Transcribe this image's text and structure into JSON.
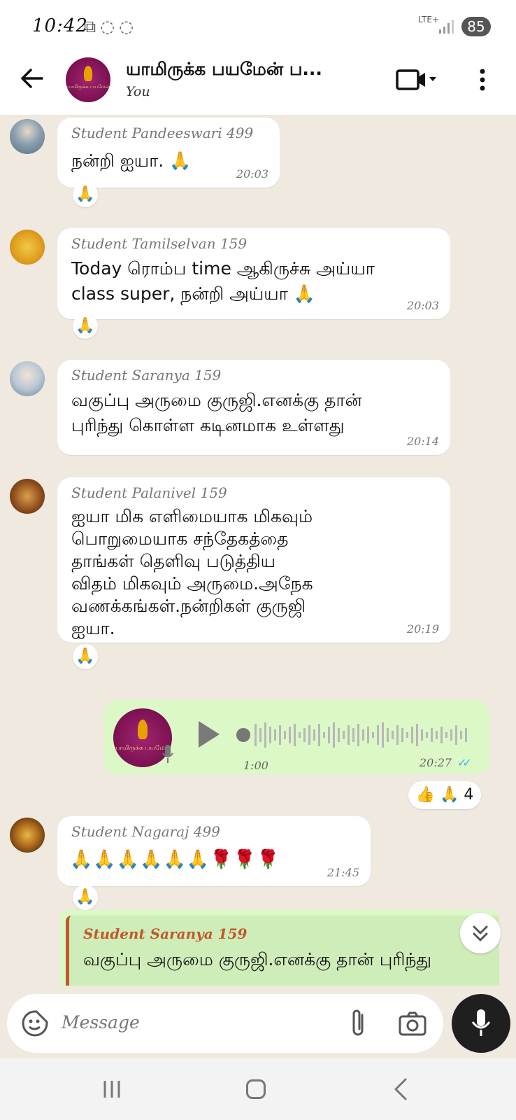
{
  "status_bar": {
    "time": "10:42",
    "network": "LTE+",
    "battery": "85"
  },
  "header": {
    "title": "யாமிருக்க பயமேன் ப...",
    "subtitle": "You",
    "avatar_text": "யாமிருக்க பயமேன்"
  },
  "messages": [
    {
      "sender": "Student Pandeeswari 499",
      "text": "நன்றி ஐயா. 🙏",
      "time": "20:03",
      "reaction": "🙏"
    },
    {
      "sender": "Student Tamilselvan 159",
      "lines": [
        "Today ரொம்ப time ஆகிருச்சு அய்யா",
        "class super, நன்றி அய்யா 🙏"
      ],
      "time": "20:03",
      "reaction": "🙏"
    },
    {
      "sender": "Student Saranya 159",
      "lines": [
        "வகுப்பு அருமை குருஜி.எனக்கு தான்",
        "புரிந்து கொள்ள கடினமாக உள்ளது"
      ],
      "time": "20:14"
    },
    {
      "sender": "Student Palanivel 159",
      "lines": [
        "ஐயா மிக எளிமையாக மிகவும்",
        "பொறுமையாக சந்தேகத்தை",
        "தாங்கள் தெளிவு படுத்திய",
        "விதம் மிகவும் அருமை.அநேக",
        "வணக்கங்கள்.நன்றிகள் குருஜி",
        "ஐயா."
      ],
      "time": "20:19",
      "reaction": "🙏"
    },
    {
      "sender": "Student Nagaraj 499",
      "text": "🙏🙏🙏🙏🙏🙏🌹🌹🌹",
      "time": "21:45",
      "reaction": "🙏"
    }
  ],
  "voice_message": {
    "duration": "1:00",
    "time": "20:27",
    "reactions": "👍 🙏 4",
    "ticks": "✓✓"
  },
  "reply_preview": {
    "sender": "Student Saranya 159",
    "text": "வகுப்பு அருமை குருஜி.எனக்கு தான் புரிந்து"
  },
  "composer": {
    "placeholder": "Message"
  },
  "colors": {
    "outgoing_bubble": "#dcf8c6",
    "incoming_bubble": "#ffffff",
    "background": "#efe9e0",
    "read_ticks": "#34b7f1",
    "quote_accent": "#c0592a"
  }
}
